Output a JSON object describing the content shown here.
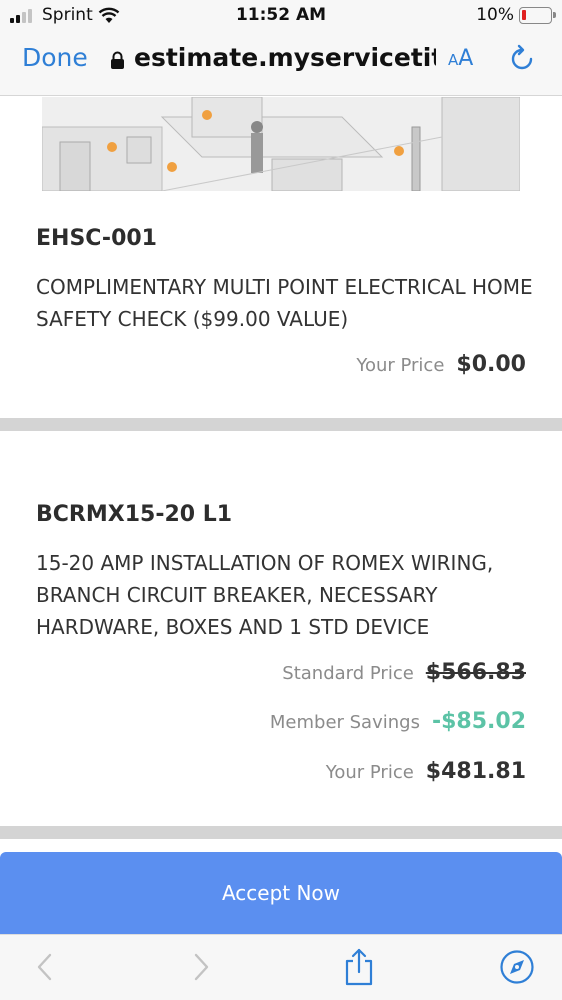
{
  "status_bar": {
    "carrier": "Sprint",
    "time": "11:52 AM",
    "battery": "10%",
    "battery_color": "#e02020"
  },
  "browser": {
    "done_label": "Done",
    "url": "estimate.myservicetitan.com",
    "text_size_label_small": "A",
    "text_size_label_large": "A",
    "accent": "#2f7fd6"
  },
  "items": [
    {
      "code": "EHSC-001",
      "description": "COMPLIMENTARY MULTI POINT ELECTRICAL HOME SAFETY CHECK ($99.00 VALUE)",
      "your_price_label": "Your Price",
      "your_price": "$0.00"
    },
    {
      "code": "BCRMX15-20 L1",
      "description": "15-20 AMP INSTALLATION OF ROMEX WIRING, BRANCH CIRCUIT BREAKER, NECESSARY HARDWARE, BOXES AND 1 STD DEVICE",
      "standard_price_label": "Standard Price",
      "standard_price": "$566.83",
      "member_savings_label": "Member Savings",
      "member_savings": "-$85.02",
      "your_price_label": "Your Price",
      "your_price": "$481.81"
    }
  ],
  "accept_button": {
    "label": "Accept Now",
    "color": "#5b8ff0"
  },
  "toolbar": {
    "icons": [
      "back-icon",
      "forward-icon",
      "share-icon",
      "compass-icon"
    ]
  },
  "colors": {
    "savings": "#5cc3a6",
    "divider": "#d4d4d4"
  }
}
